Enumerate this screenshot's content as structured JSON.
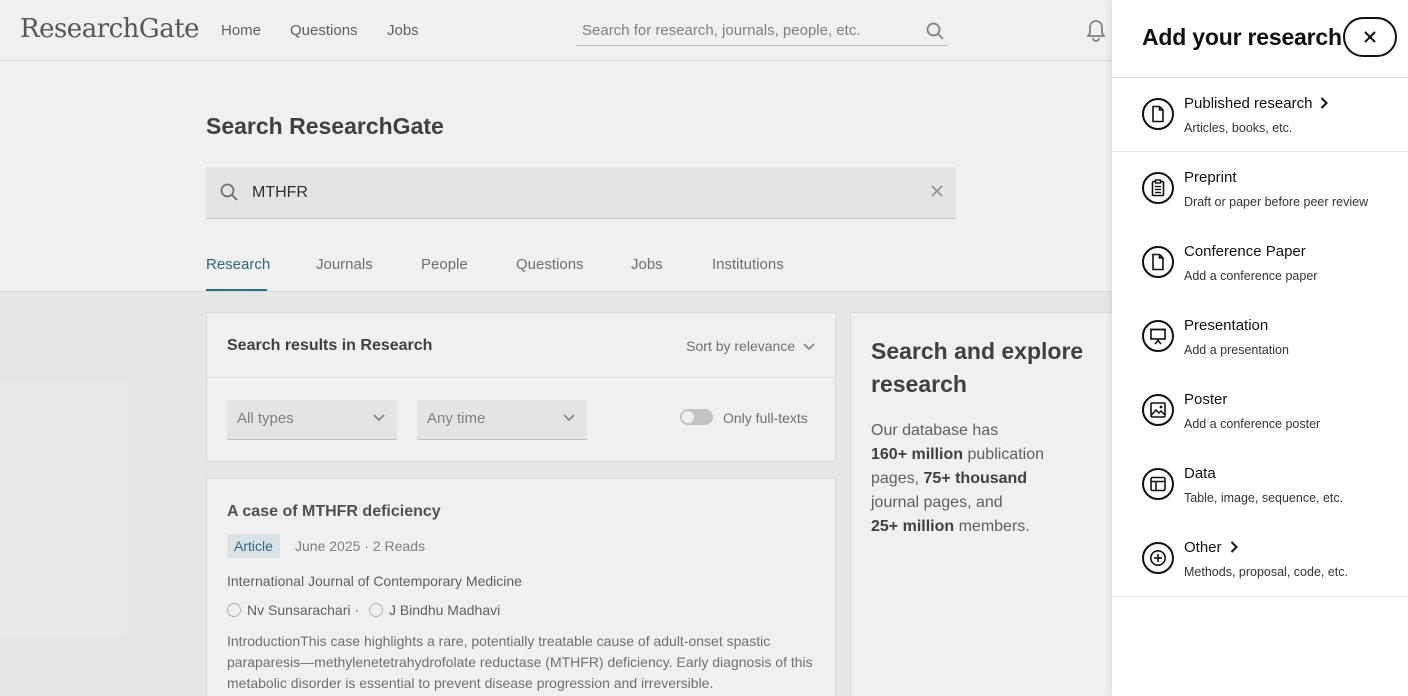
{
  "topbar": {
    "logo": "ResearchGate",
    "nav": [
      "Home",
      "Questions",
      "Jobs"
    ],
    "search_placeholder": "Search for research, journals, people, etc."
  },
  "hero": {
    "title": "Search ResearchGate",
    "query": "MTHFR",
    "tabs": [
      "Research",
      "Journals",
      "People",
      "Questions",
      "Jobs",
      "Institutions"
    ],
    "active_tab": "Research"
  },
  "results": {
    "heading": "Search results in Research",
    "sort_label": "Sort by relevance",
    "filter_type": "All types",
    "filter_time": "Any time",
    "only_fulltexts": "Only full-texts"
  },
  "card": {
    "title": "A case of MTHFR deficiency",
    "badge": "Article",
    "meta": "June 2025 · 2 Reads",
    "journal": "International Journal of Contemporary Medicine",
    "author1": "Nv Sunsarachari ·",
    "author2": "J Bindhu Madhavi",
    "abstract": "IntroductionThis case highlights a rare, potentially treatable cause of adult-onset spastic paraparesis—methylenetetrahydrofolate reductase (MTHFR) deficiency. Early diagnosis of this metabolic disorder is essential to prevent disease progression and irreversible."
  },
  "side": {
    "title": "Search and explore research",
    "text_1": "Our database has",
    "text_2": "160+ million",
    "text_3": "publication pages,",
    "text_4": "75+ thousand",
    "text_5": "journal pages, and",
    "text_6": "25+ million",
    "text_7": "members."
  },
  "drawer": {
    "title": "Add your research",
    "items": [
      {
        "label": "Published research",
        "sub": "Articles, books, etc.",
        "icon": "document-icon",
        "has_chevron": true
      },
      {
        "label": "Preprint",
        "sub": "Draft or paper before peer review",
        "icon": "clipboard-icon",
        "has_chevron": false
      },
      {
        "label": "Conference Paper",
        "sub": "Add a conference paper",
        "icon": "document-icon",
        "has_chevron": false
      },
      {
        "label": "Presentation",
        "sub": "Add a presentation",
        "icon": "presentation-board-icon",
        "has_chevron": false
      },
      {
        "label": "Poster",
        "sub": "Add a conference poster",
        "icon": "image-icon",
        "has_chevron": false
      },
      {
        "label": "Data",
        "sub": "Table, image, sequence, etc.",
        "icon": "layout-table-icon",
        "has_chevron": false
      },
      {
        "label": "Other",
        "sub": "Methods, proposal, code, etc.",
        "icon": "plus-circle-icon",
        "has_chevron": true
      }
    ]
  },
  "colors": {
    "accent": "#35708a",
    "text": "#111111",
    "background_page": "#f6f6f6"
  }
}
